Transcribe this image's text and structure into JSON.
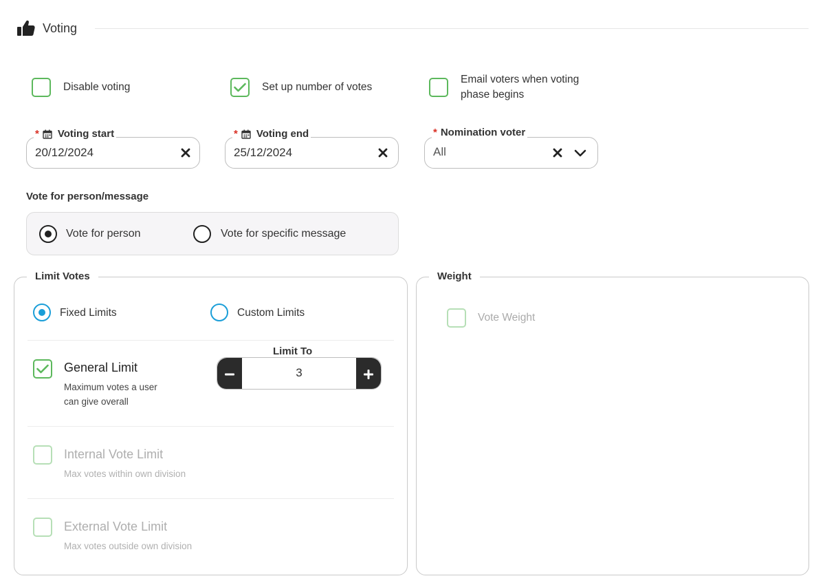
{
  "section": {
    "title": "Voting",
    "icon": "thumbs-up-icon"
  },
  "options": {
    "disable_voting": {
      "label": "Disable voting",
      "checked": false
    },
    "setup_votes": {
      "label": "Set up number of votes",
      "checked": true
    },
    "email_voters": {
      "label_line1": "Email voters when voting",
      "label_line2": "phase begins",
      "checked": false
    }
  },
  "fields": {
    "voting_start": {
      "label": "Voting start",
      "required": "*",
      "value": "20/12/2024"
    },
    "voting_end": {
      "label": "Voting end",
      "required": "*",
      "value": "25/12/2024"
    },
    "nomination_voter": {
      "label": "Nomination voter",
      "required": "*",
      "value": "All"
    }
  },
  "vote_for": {
    "title": "Vote for person/message",
    "options": [
      {
        "label": "Vote for person",
        "selected": true
      },
      {
        "label": "Vote for specific message",
        "selected": false
      }
    ]
  },
  "limit_votes": {
    "title": "Limit Votes",
    "modes": [
      {
        "label": "Fixed Limits",
        "selected": true
      },
      {
        "label": "Custom Limits",
        "selected": false
      }
    ],
    "general": {
      "title": "General Limit",
      "desc_line1": "Maximum votes a user",
      "desc_line2": "can give overall",
      "checked": true
    },
    "limit_to": {
      "label": "Limit To",
      "value": "3"
    },
    "internal": {
      "title": "Internal Vote Limit",
      "desc": "Max votes within own division",
      "checked": false
    },
    "external": {
      "title": "External Vote Limit",
      "desc": "Max votes outside own division",
      "checked": false
    }
  },
  "weight": {
    "title": "Weight",
    "vote_weight": {
      "label": "Vote Weight",
      "checked": false
    }
  },
  "colors": {
    "green": "#5cb85c",
    "blue": "#1a9ed8",
    "required": "#d93025",
    "dark": "#2b2b2b"
  }
}
